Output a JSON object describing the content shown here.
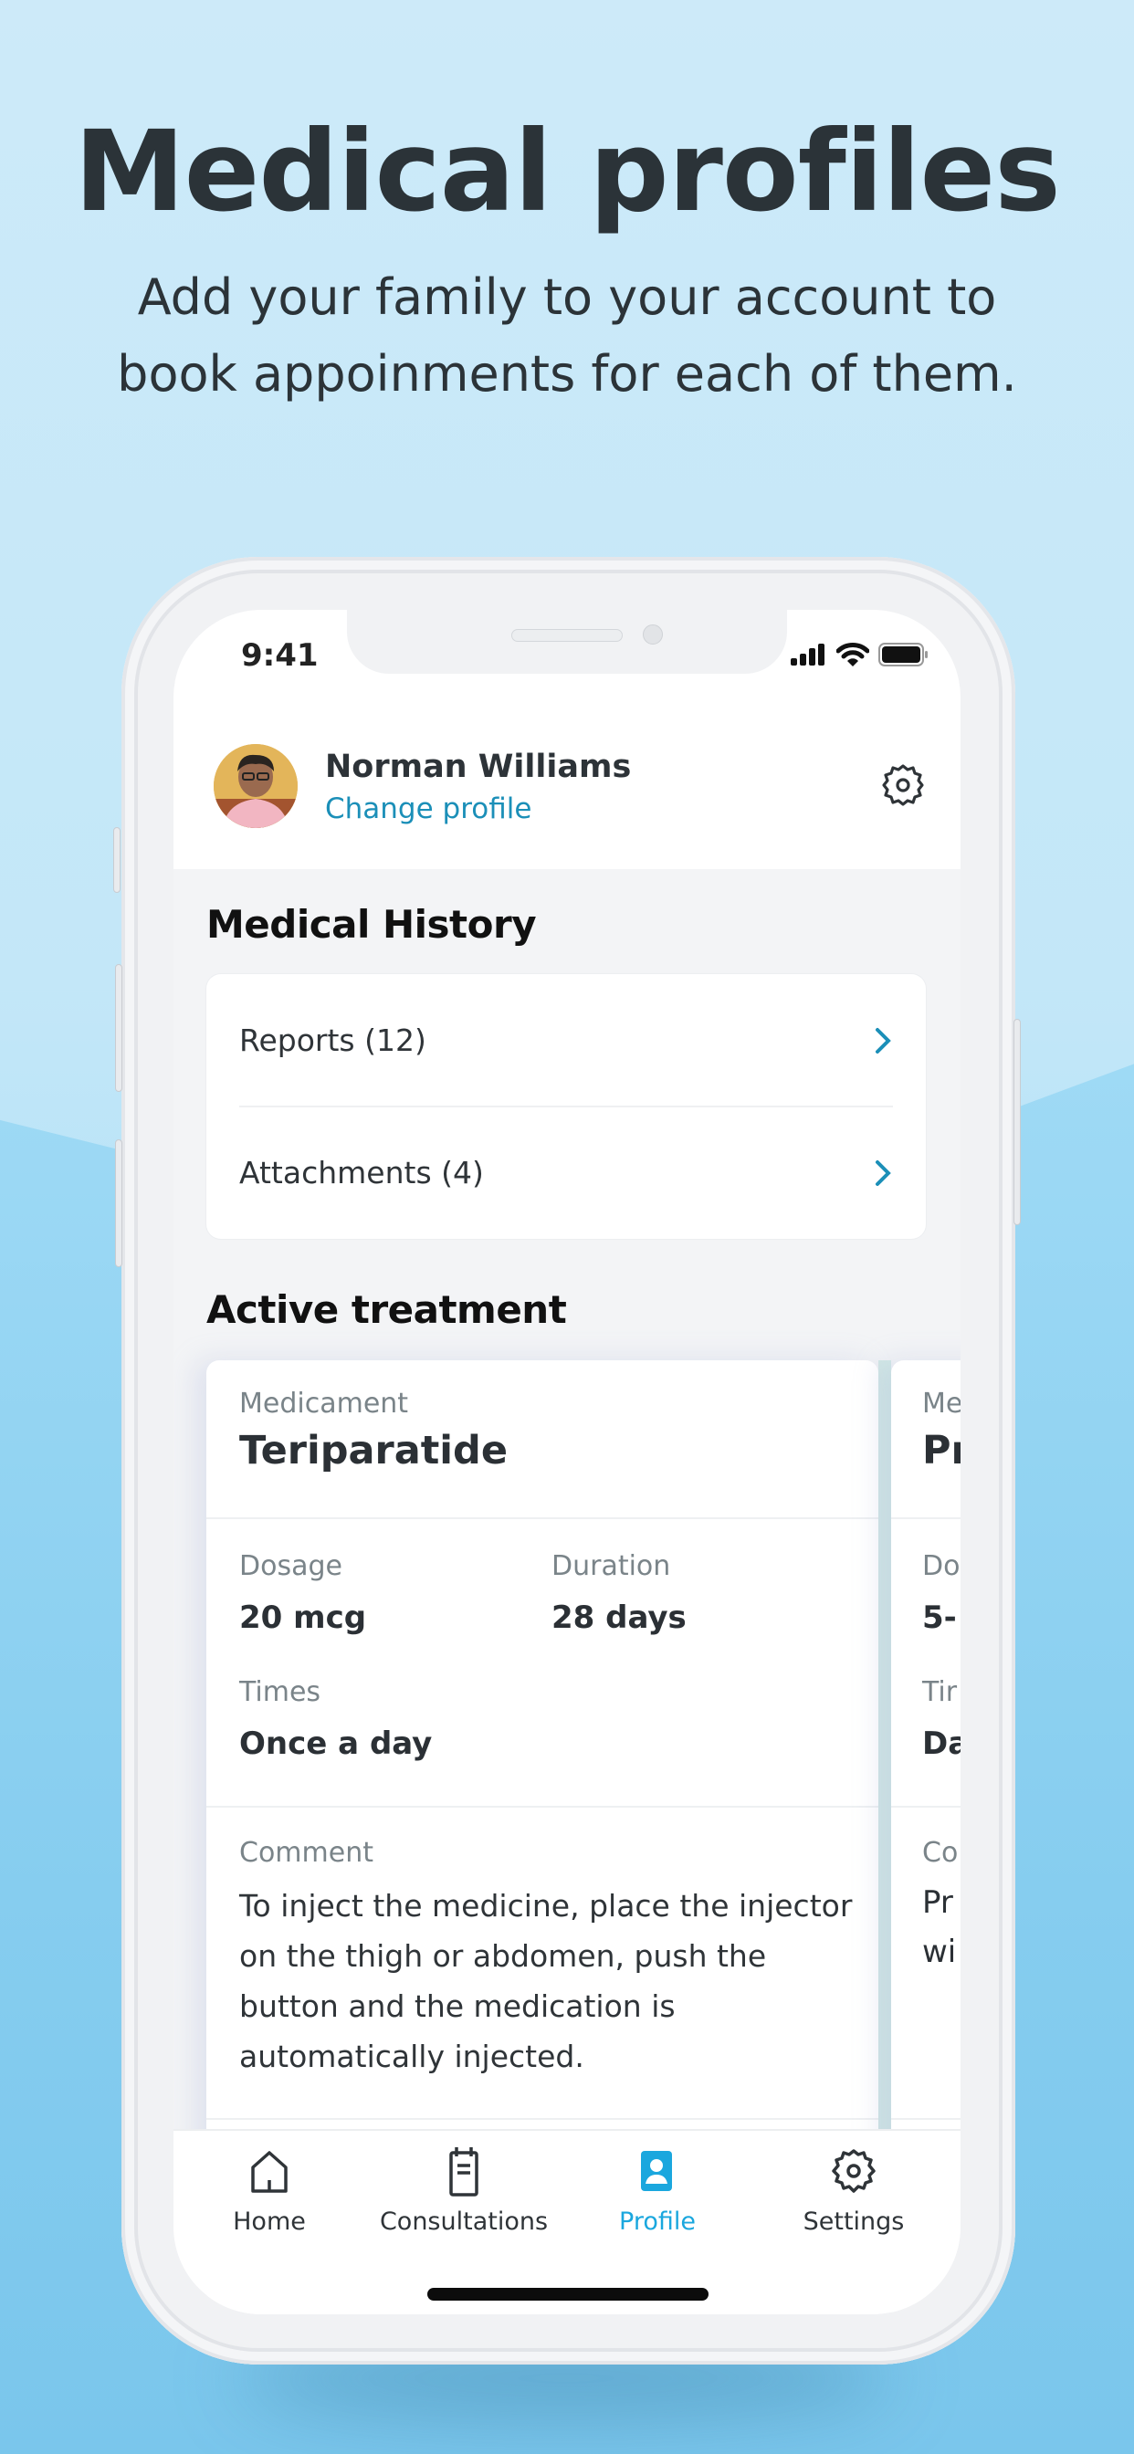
{
  "hero": {
    "title": "Medical profiles",
    "subtitle_line1": "Add your family to your account to",
    "subtitle_line2": "book appoinments for each of them."
  },
  "status_bar": {
    "time": "9:41",
    "icons": [
      "signal-icon",
      "wifi-icon",
      "battery-icon"
    ]
  },
  "profile": {
    "name": "Norman Williams",
    "change_label": "Change profile",
    "settings_icon": "gear-icon"
  },
  "medical_history": {
    "title": "Medical History",
    "items": [
      {
        "label": "Reports (12)",
        "icon": "chevron-right-icon"
      },
      {
        "label": "Attachments (4)",
        "icon": "chevron-right-icon"
      }
    ]
  },
  "active_treatment": {
    "title": "Active treatment",
    "cards": [
      {
        "medicament_label": "Medicament",
        "medicament": "Teriparatide",
        "dosage_label": "Dosage",
        "dosage": "20 mcg",
        "duration_label": "Duration",
        "duration": "28 days",
        "times_label": "Times",
        "times": "Once a day",
        "comment_label": "Comment",
        "comment": "To inject the medicine, place the injector on the thigh or abdomen, push the button and the medication is automatically injected."
      },
      {
        "medicament_label": "Me",
        "medicament": "Pr",
        "dosage_label": "Do",
        "dosage": "5-",
        "times_label": "Tir",
        "times": "Da",
        "comment_label": "Co",
        "comment_line1": "Pr",
        "comment_line2": "wi"
      }
    ]
  },
  "tabbar": {
    "active": "Profile",
    "accent_color": "#1aa7de",
    "tabs": [
      {
        "label": "Home",
        "icon": "home-icon"
      },
      {
        "label": "Consultations",
        "icon": "clipboard-icon"
      },
      {
        "label": "Profile",
        "icon": "profile-icon"
      },
      {
        "label": "Settings",
        "icon": "gear-icon"
      }
    ]
  },
  "colors": {
    "link": "#1b8fb8",
    "chevron": "#1b8fb8",
    "text_dark": "#2b3035",
    "label_gray": "#7a8489"
  }
}
